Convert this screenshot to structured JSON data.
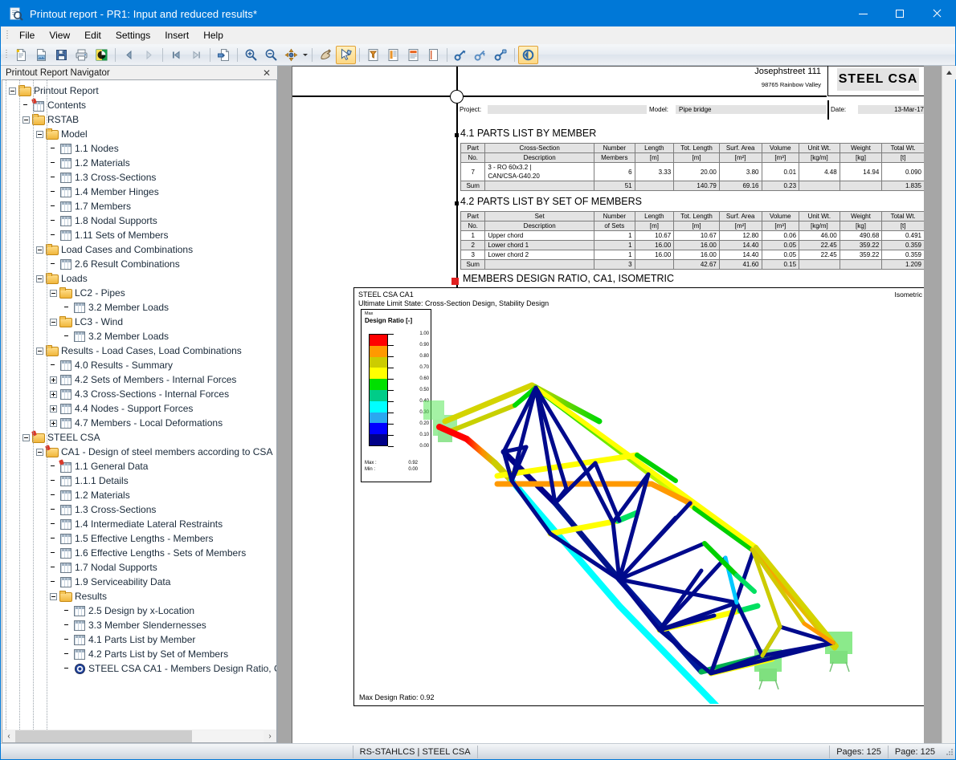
{
  "window": {
    "title": "Printout report - PR1: Input and reduced results*",
    "app_icon": "printout-report-icon",
    "minimize": "–",
    "maximize": "□",
    "close": "✕"
  },
  "menu": {
    "items": [
      {
        "label": "File"
      },
      {
        "label": "View"
      },
      {
        "label": "Edit"
      },
      {
        "label": "Settings"
      },
      {
        "label": "Insert"
      },
      {
        "label": "Help"
      }
    ]
  },
  "toolbar": {
    "buttons": [
      {
        "name": "new-report-icon"
      },
      {
        "name": "open-report-icon"
      },
      {
        "name": "save-icon"
      },
      {
        "name": "print-icon"
      },
      {
        "name": "print-preview-icon"
      },
      {
        "name": "previous-icon"
      },
      {
        "name": "next-icon"
      },
      {
        "name": "first-page-icon"
      },
      {
        "name": "last-page-icon"
      },
      {
        "name": "export-icon"
      },
      {
        "name": "zoom-in-icon"
      },
      {
        "name": "zoom-out-icon"
      },
      {
        "name": "view-settings-icon"
      },
      {
        "name": "pan-hand-icon"
      },
      {
        "name": "select-arrow-icon"
      },
      {
        "name": "filter-icon"
      },
      {
        "name": "page-header-icon"
      },
      {
        "name": "page-content-icon"
      },
      {
        "name": "blank-page-icon"
      },
      {
        "name": "link-icon"
      },
      {
        "name": "unlink-icon"
      },
      {
        "name": "lock-icon"
      },
      {
        "name": "refresh-icon"
      }
    ]
  },
  "navigator": {
    "title": "Printout Report Navigator",
    "close_label": "✕",
    "tree": [
      {
        "depth": 0,
        "label": "Printout Report",
        "icon": "folder",
        "expander": "minus"
      },
      {
        "depth": 1,
        "label": "Contents",
        "icon": "pin",
        "expander": "none"
      },
      {
        "depth": 1,
        "label": "RSTAB",
        "icon": "folder",
        "expander": "minus"
      },
      {
        "depth": 2,
        "label": "Model",
        "icon": "folder",
        "expander": "minus"
      },
      {
        "depth": 3,
        "label": "1.1 Nodes",
        "icon": "table",
        "expander": "none"
      },
      {
        "depth": 3,
        "label": "1.2 Materials",
        "icon": "table",
        "expander": "none"
      },
      {
        "depth": 3,
        "label": "1.3 Cross-Sections",
        "icon": "table",
        "expander": "none"
      },
      {
        "depth": 3,
        "label": "1.4 Member Hinges",
        "icon": "table",
        "expander": "none"
      },
      {
        "depth": 3,
        "label": "1.7 Members",
        "icon": "table",
        "expander": "none"
      },
      {
        "depth": 3,
        "label": "1.8 Nodal Supports",
        "icon": "table",
        "expander": "none"
      },
      {
        "depth": 3,
        "label": "1.11 Sets of Members",
        "icon": "table",
        "expander": "none"
      },
      {
        "depth": 2,
        "label": "Load Cases and Combinations",
        "icon": "folder",
        "expander": "minus"
      },
      {
        "depth": 3,
        "label": "2.6 Result Combinations",
        "icon": "table",
        "expander": "none"
      },
      {
        "depth": 2,
        "label": "Loads",
        "icon": "folder",
        "expander": "minus"
      },
      {
        "depth": 3,
        "label": "LC2 - Pipes",
        "icon": "folder",
        "expander": "minus"
      },
      {
        "depth": 4,
        "label": "3.2 Member Loads",
        "icon": "table",
        "expander": "none"
      },
      {
        "depth": 3,
        "label": "LC3 - Wind",
        "icon": "folder",
        "expander": "minus"
      },
      {
        "depth": 4,
        "label": "3.2 Member Loads",
        "icon": "table",
        "expander": "none"
      },
      {
        "depth": 2,
        "label": "Results - Load Cases, Load Combinations",
        "icon": "folder",
        "expander": "minus"
      },
      {
        "depth": 3,
        "label": "4.0 Results - Summary",
        "icon": "table",
        "expander": "none"
      },
      {
        "depth": 3,
        "label": "4.2 Sets of Members - Internal Forces",
        "icon": "table",
        "expander": "plus"
      },
      {
        "depth": 3,
        "label": "4.3 Cross-Sections - Internal Forces",
        "icon": "table",
        "expander": "plus"
      },
      {
        "depth": 3,
        "label": "4.4 Nodes - Support Forces",
        "icon": "table",
        "expander": "plus"
      },
      {
        "depth": 3,
        "label": "4.7 Members - Local Deformations",
        "icon": "table",
        "expander": "plus"
      },
      {
        "depth": 1,
        "label": "STEEL CSA",
        "icon": "folderpin",
        "expander": "minus"
      },
      {
        "depth": 2,
        "label": "CA1 - Design of steel members according to CSA",
        "icon": "folderpin",
        "expander": "minus"
      },
      {
        "depth": 3,
        "label": "1.1 General Data",
        "icon": "pin",
        "expander": "none"
      },
      {
        "depth": 3,
        "label": "1.1.1 Details",
        "icon": "table",
        "expander": "none"
      },
      {
        "depth": 3,
        "label": "1.2 Materials",
        "icon": "table",
        "expander": "none"
      },
      {
        "depth": 3,
        "label": "1.3 Cross-Sections",
        "icon": "table",
        "expander": "none"
      },
      {
        "depth": 3,
        "label": "1.4 Intermediate Lateral Restraints",
        "icon": "table",
        "expander": "none"
      },
      {
        "depth": 3,
        "label": "1.5 Effective Lengths - Members",
        "icon": "table",
        "expander": "none"
      },
      {
        "depth": 3,
        "label": "1.6 Effective Lengths - Sets of Members",
        "icon": "table",
        "expander": "none"
      },
      {
        "depth": 3,
        "label": "1.7 Nodal Supports",
        "icon": "table",
        "expander": "none"
      },
      {
        "depth": 3,
        "label": "1.9 Serviceability Data",
        "icon": "table",
        "expander": "none"
      },
      {
        "depth": 3,
        "label": "Results",
        "icon": "folder",
        "expander": "minus"
      },
      {
        "depth": 4,
        "label": "2.5 Design by x-Location",
        "icon": "table",
        "expander": "none"
      },
      {
        "depth": 4,
        "label": "3.3 Member Slendernesses",
        "icon": "table",
        "expander": "none"
      },
      {
        "depth": 4,
        "label": "4.1 Parts List by Member",
        "icon": "table",
        "expander": "none"
      },
      {
        "depth": 4,
        "label": "4.2 Parts List by Set of Members",
        "icon": "table",
        "expander": "none"
      },
      {
        "depth": 4,
        "label": "STEEL CSA CA1 - Members Design Ratio, C",
        "icon": "graphic",
        "expander": "none"
      }
    ],
    "hscroll": {
      "left_arrow": "‹",
      "right_arrow": "›"
    }
  },
  "report": {
    "company_address_line1": "Josephstreet 111",
    "company_address_line2": "98765 Rainbow Valley",
    "brand_box": "STEEL CSA",
    "fields": {
      "project_label": "Project:",
      "project_value": "",
      "model_label": "Model:",
      "model_value": "Pipe bridge",
      "date_label": "Date:",
      "date_value": "13-Mar-17"
    },
    "section_41": {
      "title": "4.1 PARTS LIST BY MEMBER",
      "headers_top": [
        "Part",
        "Cross-Section",
        "Number",
        "Length",
        "Tot. Length",
        "Surf. Area",
        "Volume",
        "Unit Wt.",
        "Weight",
        "Total Wt."
      ],
      "headers_bottom": [
        "No.",
        "Description",
        "Members",
        "[m]",
        "[m]",
        "[m²]",
        "[m³]",
        "[kg/m]",
        "[kg]",
        "[t]"
      ],
      "rows": [
        {
          "cells": [
            "7",
            "3 - RO 60x3.2 |\nCAN/CSA-G40.20",
            "6",
            "3.33",
            "20.00",
            "3.80",
            "0.01",
            "4.48",
            "14.94",
            "0.090"
          ],
          "shaded": false
        }
      ],
      "sum": {
        "cells": [
          "Sum",
          "",
          "51",
          "",
          "140.79",
          "69.16",
          "0.23",
          "",
          "",
          "1.835"
        ]
      }
    },
    "section_42": {
      "title": "4.2 PARTS LIST BY SET OF MEMBERS",
      "headers_top": [
        "Part",
        "Set",
        "Number",
        "Length",
        "Tot. Length",
        "Surf. Area",
        "Volume",
        "Unit Wt.",
        "Weight",
        "Total Wt."
      ],
      "headers_bottom": [
        "No.",
        "Description",
        "of Sets",
        "[m]",
        "[m]",
        "[m²]",
        "[m³]",
        "[kg/m]",
        "[kg]",
        "[t]"
      ],
      "rows": [
        {
          "cells": [
            "1",
            "Upper chord",
            "1",
            "10.67",
            "10.67",
            "12.80",
            "0.06",
            "46.00",
            "490.68",
            "0.491"
          ],
          "shaded": false
        },
        {
          "cells": [
            "2",
            "Lower chord 1",
            "1",
            "16.00",
            "16.00",
            "14.40",
            "0.05",
            "22.45",
            "359.22",
            "0.359"
          ],
          "shaded": true
        },
        {
          "cells": [
            "3",
            "Lower chord 2",
            "1",
            "16.00",
            "16.00",
            "14.40",
            "0.05",
            "22.45",
            "359.22",
            "0.359"
          ],
          "shaded": false
        }
      ],
      "sum": {
        "cells": [
          "Sum",
          "",
          "3",
          "",
          "42.67",
          "41.60",
          "0.15",
          "",
          "",
          "1.209"
        ]
      }
    },
    "figure": {
      "title": "MEMBERS DESIGN RATIO, CA1, ISOMETRIC",
      "header_line1": "STEEL CSA CA1",
      "header_line2": "Ultimate Limit State: Cross-Section Design, Stability Design",
      "view_label": "Isometric",
      "footer": "Max Design Ratio: 0.92"
    }
  },
  "chart_data": {
    "type": "heatmap",
    "title": "Design Ratio [-]",
    "subtitle": "Max",
    "legend_position": "left",
    "colorbar": {
      "ticks": [
        "1.00",
        "0.90",
        "0.80",
        "0.70",
        "0.60",
        "0.50",
        "0.40",
        "0.30",
        "0.20",
        "0.10",
        "0.00"
      ],
      "colors": [
        "#ff0000",
        "#ff9900",
        "#cccc00",
        "#ffff00",
        "#00e000",
        "#00cc88",
        "#00ffff",
        "#2aa8f0",
        "#0000ff",
        "#000088"
      ]
    },
    "max_label": "Max :",
    "max_value": "0.92",
    "min_label": "Min :",
    "min_value": "0.00",
    "ylim": [
      0,
      1
    ]
  },
  "statusbar": {
    "module": "RS-STAHLCS | STEEL CSA",
    "pages": "Pages: 125",
    "page": "Page: 125"
  }
}
